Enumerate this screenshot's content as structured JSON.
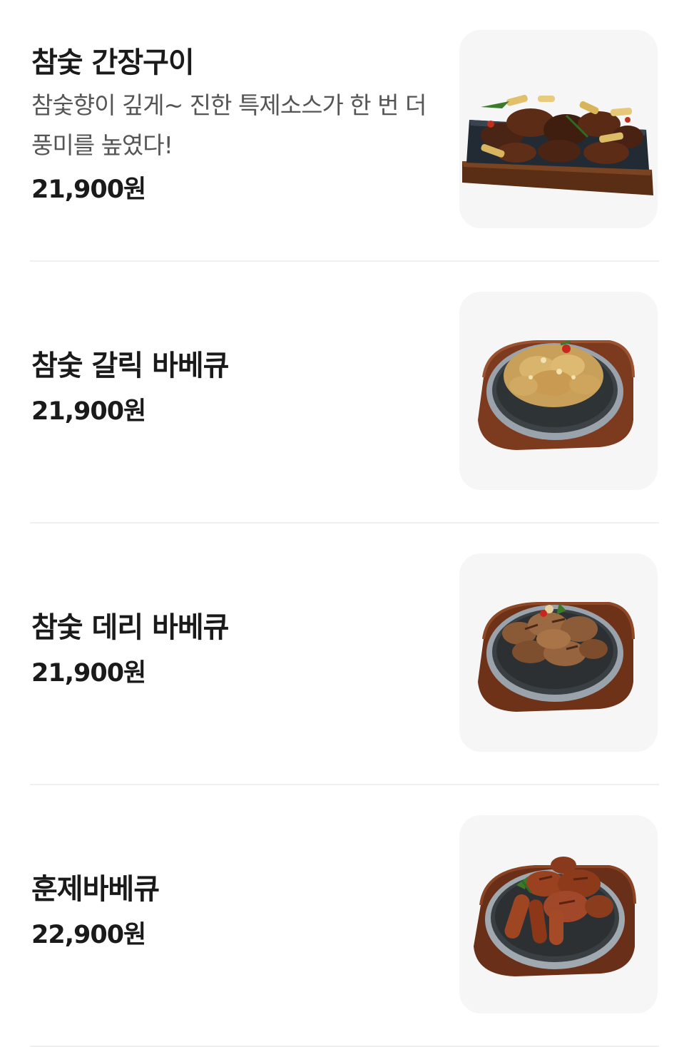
{
  "menu_items": [
    {
      "name": "참숯 간장구이",
      "description": "참숯향이 깊게~ 진한 특제소스가 한 번 더 풍미를 높였다!",
      "price": "21,900원",
      "image": "soy-grilled-chicken-on-iron-plate"
    },
    {
      "name": "참숯 갈릭 바베큐",
      "price": "21,900원",
      "image": "garlic-bbq-chicken-on-sizzling-plate"
    },
    {
      "name": "참숯 데리 바베큐",
      "price": "21,900원",
      "image": "teriyaki-bbq-chicken-on-sizzling-plate"
    },
    {
      "name": "훈제바베큐",
      "price": "22,900원",
      "image": "smoked-bbq-chicken-on-sizzling-plate"
    }
  ],
  "colors": {
    "text_primary": "#1a1a1a",
    "text_secondary": "#555555",
    "thumb_background": "#f6f6f6",
    "divider": "#f0f0f0"
  }
}
